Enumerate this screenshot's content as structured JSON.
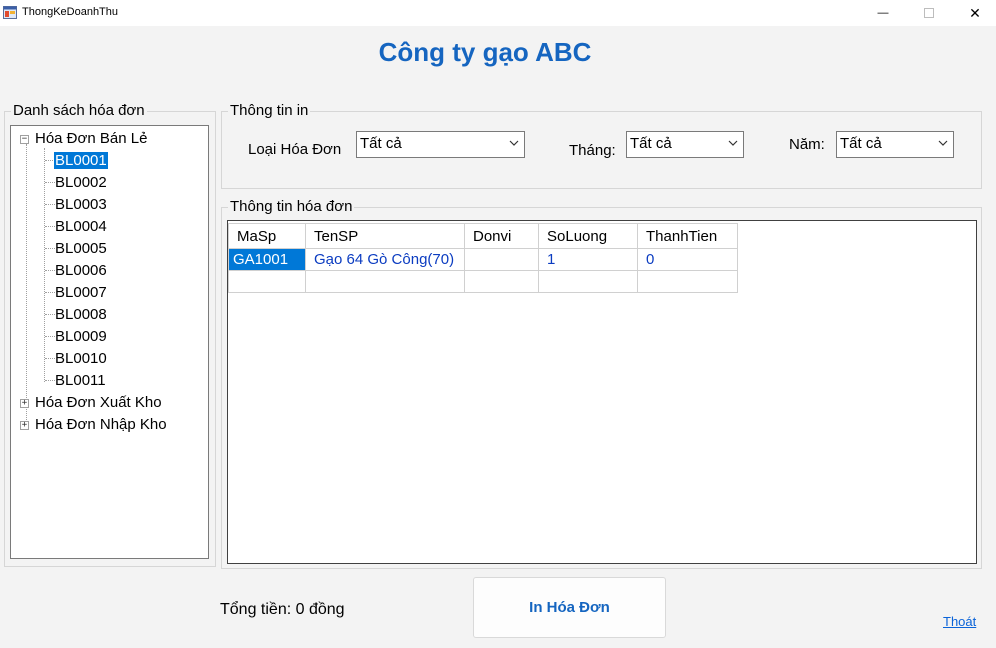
{
  "window": {
    "title": "ThongKeDoanhThu",
    "close_glyph": "✕",
    "minimize_glyph": "—",
    "icons": {
      "app": "app-icon",
      "minimize": "minimize-icon",
      "maximize": "maximize-icon",
      "close": "close-icon"
    }
  },
  "company_title": "Công ty gạo ABC",
  "tree_panel": {
    "legend": "Danh sách hóa đơn",
    "expander_collapsed": "+",
    "expander_expanded": "−",
    "nodes": [
      {
        "label": "Hóa Đơn Bán Lẻ",
        "expanded": true
      },
      {
        "label": "BL0001",
        "selected": true
      },
      {
        "label": "BL0002"
      },
      {
        "label": "BL0003"
      },
      {
        "label": "BL0004"
      },
      {
        "label": "BL0005"
      },
      {
        "label": "BL0006"
      },
      {
        "label": "BL0007"
      },
      {
        "label": "BL0008"
      },
      {
        "label": "BL0009"
      },
      {
        "label": "BL0010"
      },
      {
        "label": "BL0011"
      },
      {
        "label": "Hóa Đơn Xuất Kho",
        "expanded": false
      },
      {
        "label": "Hóa Đơn Nhập Kho",
        "expanded": false
      }
    ]
  },
  "print_info": {
    "legend": "Thông tin in",
    "loai_hoa_don": {
      "label": "Loại Hóa Đơn",
      "value": "Tất cả"
    },
    "thang": {
      "label": "Tháng:",
      "value": "Tất cả"
    },
    "nam": {
      "label": "Năm:",
      "value": "Tất cả"
    }
  },
  "invoice_info": {
    "legend": "Thông tin hóa đơn",
    "columns": [
      "MaSp",
      "TenSP",
      "Donvi",
      "SoLuong",
      "ThanhTien"
    ],
    "rows": [
      [
        "GA1001",
        "Gạo 64 Gò Công(70)",
        "",
        "1",
        "0"
      ],
      [
        "",
        "",
        "",
        "",
        ""
      ]
    ]
  },
  "footer": {
    "total_label": "Tổng tiền: 0 đồng",
    "print_button": "In Hóa Đơn",
    "exit_link": "Thoát"
  },
  "colors": {
    "accent": "#1565c0",
    "selection": "#0078d7",
    "link": "#0a63d8",
    "grid_text": "#0b3cc1"
  }
}
